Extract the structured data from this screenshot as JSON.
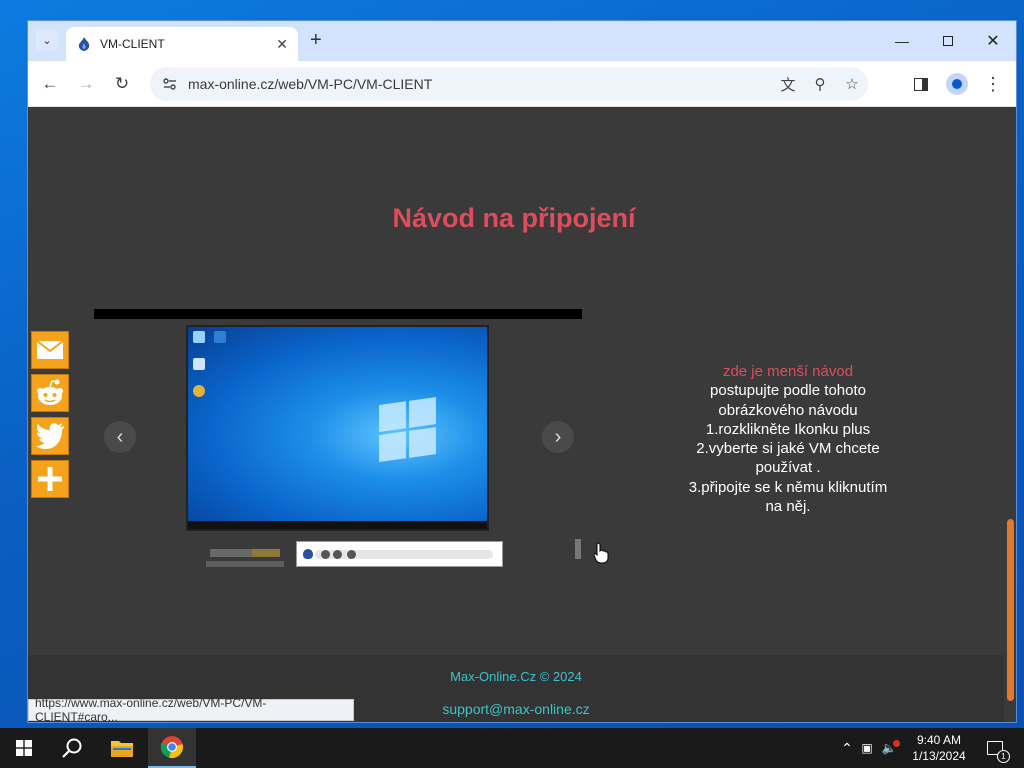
{
  "browser": {
    "tab_title": "VM-CLIENT",
    "url": "max-online.cz/web/VM-PC/VM-CLIENT",
    "status_url": "https://www.max-online.cz/web/VM-PC/VM-CLIENT#caro..."
  },
  "page": {
    "heading": "Návod na připojení",
    "instructions": {
      "line_red": "zde je menší návod",
      "line1": "postupujte podle tohoto",
      "line2": "obrázkového návodu",
      "line3": "1.rozklikněte Ikonku plus",
      "line4": "2.vyberte si jaké VM chcete",
      "line5": "používat .",
      "line6": "3.připojte se k němu kliknutím",
      "line7": "na něj."
    },
    "footer": {
      "copyright": "Max-Online.Cz © 2024",
      "email": "support@max-online.cz"
    },
    "share_buttons": [
      "email-icon",
      "reddit-icon",
      "twitter-icon",
      "plus-icon"
    ]
  },
  "taskbar": {
    "time": "9:40 AM",
    "date": "1/13/2024",
    "notification_count": "1"
  },
  "colors": {
    "heading": "#de4d5b",
    "footer_text": "#3dc3c8",
    "share_button": "#f5a31a",
    "page_bg": "#3a3a3a"
  }
}
